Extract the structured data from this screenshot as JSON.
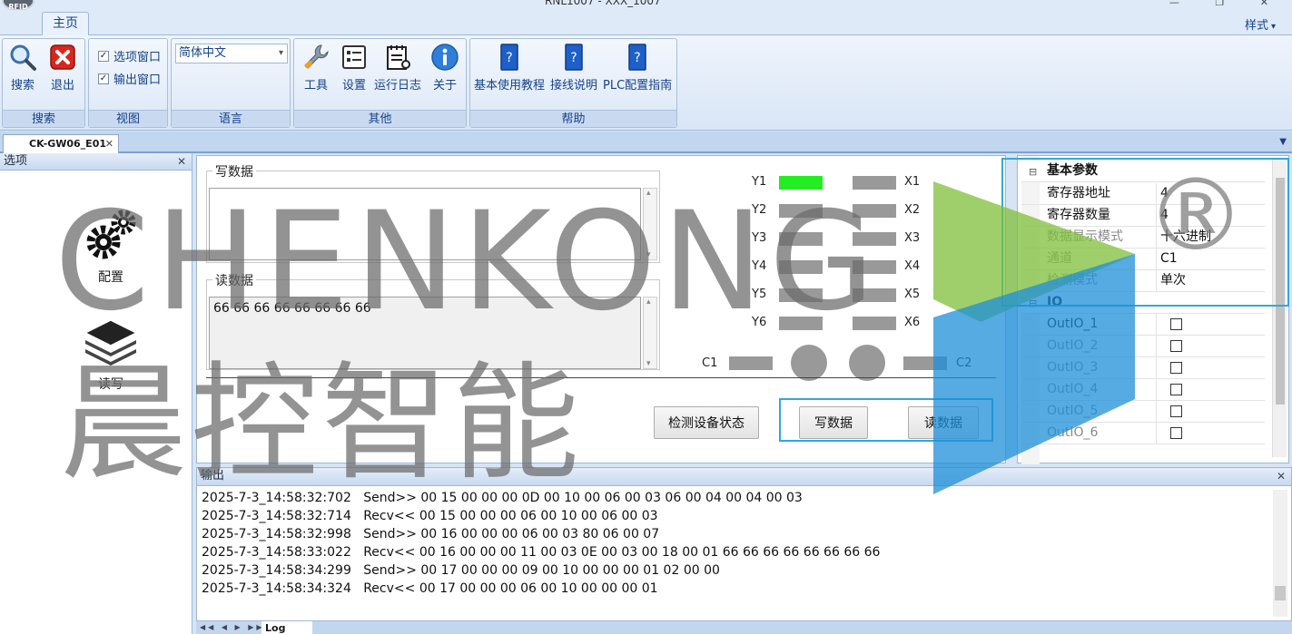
{
  "window": {
    "title": "RNL1007 - XXX_1007",
    "app_badge": "RFID",
    "controls": "— ❐ ✕"
  },
  "ribbon": {
    "tabs": [
      {
        "label": "主页"
      }
    ],
    "style_menu": "样式",
    "groups": {
      "search": {
        "label": "搜索",
        "search_btn": "搜索",
        "exit_btn": "退出"
      },
      "view": {
        "label": "视图",
        "options_window": "选项窗口",
        "output_window": "输出窗口"
      },
      "language": {
        "label": "语言",
        "selected": "简体中文"
      },
      "other": {
        "label": "其他",
        "tools": "工具",
        "settings": "设置",
        "run_log": "运行日志",
        "about": "关于"
      },
      "help": {
        "label": "帮助",
        "basic_tutorial": "基本使用教程",
        "wiring": "接线说明",
        "plc_guide": "PLC配置指南"
      }
    }
  },
  "doc_tab": {
    "label": "CK-GW06_E01"
  },
  "left_panel": {
    "title": "选项",
    "items": [
      {
        "label": "配置"
      },
      {
        "label": "读写"
      }
    ]
  },
  "main": {
    "write_label": "写数据",
    "write_value": "",
    "read_label": "读数据",
    "read_value": "66 66 66 66 66 66 66 66",
    "io": {
      "y_labels": [
        "Y1",
        "Y2",
        "Y3",
        "Y4",
        "Y5",
        "Y6"
      ],
      "x_labels": [
        "X1",
        "X2",
        "X3",
        "X4",
        "X5",
        "X6"
      ],
      "y_states": [
        1,
        0,
        0,
        0,
        0,
        0
      ],
      "x_states": [
        0,
        0,
        0,
        0,
        0,
        0
      ],
      "c1": "C1",
      "c2": "C2",
      "active_color": "#22ee22",
      "inactive_color": "#999999"
    },
    "buttons": {
      "check_status": "检测设备状态",
      "write": "写数据",
      "read": "读数据"
    }
  },
  "properties": {
    "basic_category": "基本参数",
    "basic": [
      {
        "key": "寄存器地址",
        "value": "4"
      },
      {
        "key": "寄存器数量",
        "value": "4"
      },
      {
        "key": "数据显示模式",
        "value": "十六进制"
      },
      {
        "key": "通道",
        "value": "C1"
      },
      {
        "key": "检测模式",
        "value": "单次"
      }
    ],
    "io_category": "IO",
    "io": [
      {
        "key": "OutIO_1",
        "checked": false
      },
      {
        "key": "OutIO_2",
        "checked": false
      },
      {
        "key": "OutIO_3",
        "checked": false
      },
      {
        "key": "OutIO_4",
        "checked": false
      },
      {
        "key": "OutIO_5",
        "checked": false
      },
      {
        "key": "OutIO_6",
        "checked": false
      }
    ]
  },
  "output": {
    "title": "输出",
    "lines": [
      "2025-7-3_14:58:32:702   Send>> 00 15 00 00 00 0D 00 10 00 06 00 03 06 00 04 00 04 00 03",
      "2025-7-3_14:58:32:714   Recv<< 00 15 00 00 00 06 00 10 00 06 00 03",
      "2025-7-3_14:58:32:998   Send>> 00 16 00 00 00 06 00 03 80 06 00 07",
      "2025-7-3_14:58:33:022   Recv<< 00 16 00 00 00 11 00 03 0E 00 03 00 18 00 01 66 66 66 66 66 66 66 66",
      "2025-7-3_14:58:34:299   Send>> 00 17 00 00 00 09 00 10 00 00 00 01 02 00 00",
      "2025-7-3_14:58:34:324   Recv<< 00 17 00 00 00 06 00 10 00 00 00 01"
    ],
    "log_tab": "Log",
    "log_nav": "◀◀ ◀ ▶ ▶▶"
  },
  "watermark": {
    "brand": "CHENKONG",
    "cn": "晨控智能",
    "mark": "®"
  }
}
